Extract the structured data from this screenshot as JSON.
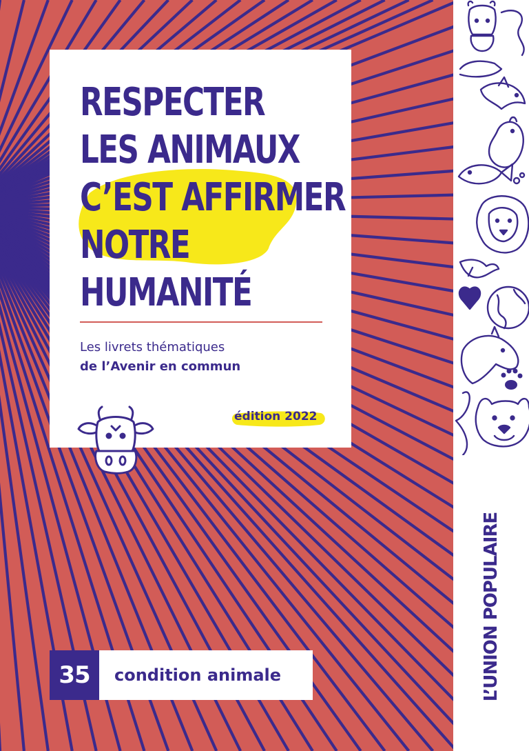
{
  "cover": {
    "title_lines": [
      "RESPECTER",
      "LES ANIMAUX",
      "C’EST AFFIRMER",
      "NOTRE",
      "HUMANITÉ"
    ],
    "subtitle_line1": "Les livrets thématiques",
    "subtitle_line2": "de l’Avenir en commun",
    "edition": "édition 2022",
    "number": "35",
    "topic": "condition animale",
    "organization": "L’UNION POPULAIRE"
  },
  "colors": {
    "background": "#d25c57",
    "line": "#3b2a8c",
    "accent_text": "#3b2a8c",
    "highlight": "#f7e81a",
    "card": "#ffffff"
  },
  "icons": [
    "cow-icon",
    "cow-doodle-icon",
    "hand-doodle-icon",
    "dolphin-doodle-icon",
    "chicken-doodle-icon",
    "fish-doodle-icon",
    "lion-doodle-icon",
    "bird-doodle-icon",
    "heart-doodle-icon",
    "globe-doodle-icon",
    "horse-doodle-icon",
    "paw-print-icon",
    "dog-doodle-icon"
  ]
}
